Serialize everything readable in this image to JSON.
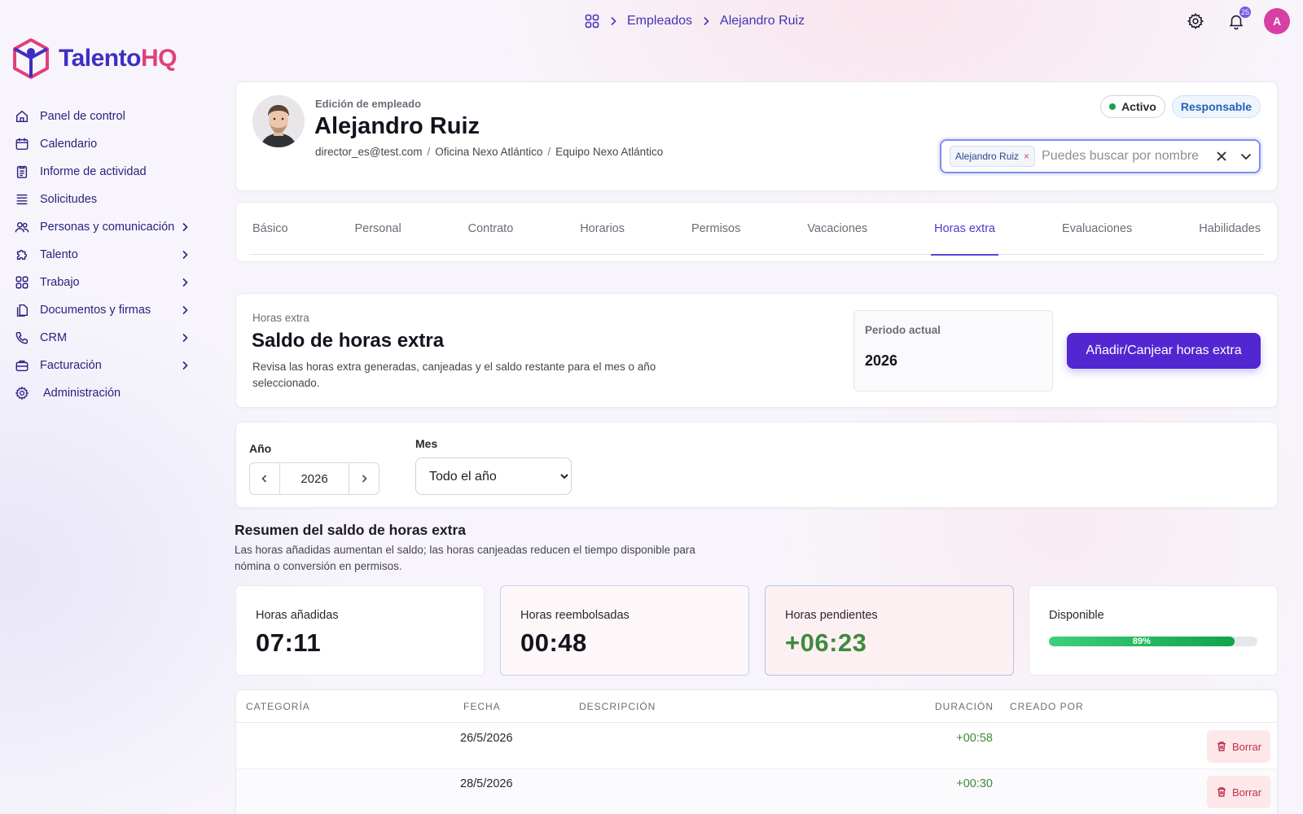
{
  "app": {
    "logo_primary": "Talento",
    "logo_accent": "HQ",
    "brand_color": "#3f2ec4",
    "accent_color": "#e2407a",
    "avatar_initial": "A",
    "notifications_count": "25"
  },
  "breadcrumb": {
    "items": [
      "Empleados",
      "Alejandro Ruiz"
    ]
  },
  "sidebar": {
    "items": [
      {
        "label": "Panel de control",
        "icon": "home-icon",
        "has_children": false
      },
      {
        "label": "Calendario",
        "icon": "calendar-icon",
        "has_children": false
      },
      {
        "label": "Informe de actividad",
        "icon": "report-icon",
        "has_children": false
      },
      {
        "label": "Solicitudes",
        "icon": "list-icon",
        "has_children": false
      },
      {
        "label": "Personas y comunicación",
        "icon": "people-icon",
        "has_children": true
      },
      {
        "label": "Talento",
        "icon": "puzzle-icon",
        "has_children": true
      },
      {
        "label": "Trabajo",
        "icon": "grid-icon",
        "has_children": true
      },
      {
        "label": "Documentos y firmas",
        "icon": "documents-icon",
        "has_children": true
      },
      {
        "label": "CRM",
        "icon": "phone-icon",
        "has_children": true
      },
      {
        "label": "Facturación",
        "icon": "briefcase-icon",
        "has_children": true
      },
      {
        "label": "Administración",
        "icon": "gear-icon",
        "has_children": false
      }
    ]
  },
  "employee": {
    "caption": "Edición de empleado",
    "name": "Alejandro Ruiz",
    "email": "director_es@test.com",
    "office": "Oficina Nexo Atlántico",
    "team": "Equipo Nexo Atlántico",
    "status_badge": "Activo",
    "role_badge": "Responsable",
    "selector_chip": "Alejandro Ruiz",
    "selector_placeholder": "Puedes buscar por nombre"
  },
  "tabs": {
    "items": [
      "Básico",
      "Personal",
      "Contrato",
      "Horarios",
      "Permisos",
      "Vacaciones",
      "Horas extra",
      "Evaluaciones",
      "Habilidades"
    ],
    "active": "Horas extra"
  },
  "overtime": {
    "eyebrow": "Horas extra",
    "title": "Saldo de horas extra",
    "description": "Revisa las horas extra generadas, canjeadas y el saldo restante para el mes o año seleccionado.",
    "period_label": "Periodo actual",
    "period_value": "2026",
    "primary_button": "Añadir/Canjear horas extra"
  },
  "filters": {
    "year_label": "Año",
    "year_value": "2026",
    "month_label": "Mes",
    "month_selected": "Todo el año"
  },
  "summary": {
    "title": "Resumen del saldo de horas extra",
    "description": "Las horas añadidas aumentan el saldo; las horas canjeadas reducen el tiempo disponible para nómina o conversión en permisos.",
    "stats": {
      "added_label": "Horas añadidas",
      "added_value": "07:11",
      "refunded_label": "Horas reembolsadas",
      "refunded_value": "00:48",
      "pending_label": "Horas pendientes",
      "pending_value": "+06:23",
      "available_label": "Disponible",
      "available_percent": 89,
      "available_text": "89%"
    }
  },
  "table": {
    "headers": {
      "category": "Categoría",
      "date": "Fecha",
      "description": "Descripción",
      "duration": "Duración",
      "created_by": "Creado por"
    },
    "delete_label": "Borrar",
    "rows": [
      {
        "category": "",
        "date": "26/5/2026",
        "description": "",
        "duration": "+00:58",
        "created_by": ""
      },
      {
        "category": "",
        "date": "28/5/2026",
        "description": "",
        "duration": "+00:30",
        "created_by": ""
      }
    ]
  }
}
